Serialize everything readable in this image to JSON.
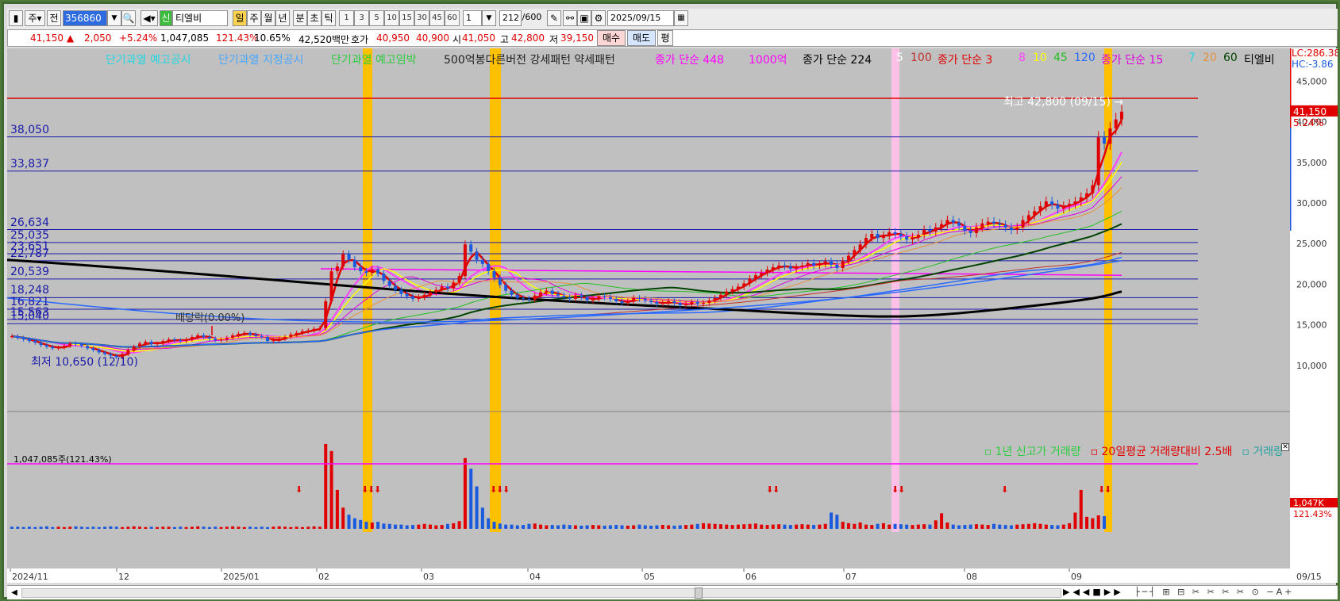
{
  "toolbar": {
    "market_select": "주",
    "prefix": "전",
    "code": "356860",
    "name_tag": "신",
    "stock_name": "티엘비",
    "period_tabs": [
      "일",
      "주",
      "월",
      "년",
      "분",
      "초",
      "틱"
    ],
    "num_buttons": [
      "1",
      "3",
      "5",
      "10",
      "15",
      "30",
      "45",
      "60"
    ],
    "interval_value": "1",
    "count_value": "212",
    "count_total": "/600",
    "date": "2025/09/15"
  },
  "pricebar": {
    "price": "41,150",
    "change_arrow": "▲",
    "change": "2,050",
    "change_pct": "+5.24%",
    "volume": "1,047,085",
    "vol_ratio": "121.43%",
    "turnover": "10.65%",
    "amount": "42,520백만",
    "quote_label": "호가",
    "ask": "40,950",
    "bid": "40,900",
    "open_label": "시",
    "open": "41,050",
    "high_label": "고",
    "high": "42,800",
    "low_label": "저",
    "low": "39,150",
    "buy_label": "매수",
    "sell_label": "매도",
    "avg_label": "평"
  },
  "legend": [
    {
      "text": "단기과열 예고공시",
      "color": "#22d8e0"
    },
    {
      "text": "단기과열 지정공시",
      "color": "#4aa8ff"
    },
    {
      "text": "단기과열 예고임박",
      "color": "#2ecc40"
    },
    {
      "text": "500억봉다른버전 강세패턴  약세패턴",
      "color": "#222222"
    },
    {
      "text": "종가 단순 448",
      "color": "#ff00ff"
    },
    {
      "text": "1000억",
      "color": "#ff00ff"
    },
    {
      "text": "종가 단순 224",
      "color": "#000000"
    },
    {
      "text": "5",
      "color": "#ffffff"
    },
    {
      "text": "100",
      "color": "#c0302a"
    },
    {
      "text": "종가 단순 3",
      "color": "#e00000"
    },
    {
      "text": "8",
      "color": "#ff40ff"
    },
    {
      "text": "10",
      "color": "#ffff00"
    },
    {
      "text": "45",
      "color": "#22c022"
    },
    {
      "text": "120",
      "color": "#2a6aff"
    },
    {
      "text": "종가 단순 15",
      "color": "#e000e0"
    },
    {
      "text": "7",
      "color": "#22d8e0"
    },
    {
      "text": "20",
      "color": "#e89040"
    },
    {
      "text": "60",
      "color": "#004400"
    },
    {
      "text": "티엘비",
      "color": "#000000"
    }
  ],
  "right_axis": {
    "lc": "LC:286.38",
    "hc": "HC:-3.86",
    "price_labels": [
      "45,000",
      "40,000",
      "35,000",
      "30,000",
      "25,000",
      "20,000",
      "15,000",
      "10,000"
    ],
    "current": "41,150",
    "current_pct": "5.24%",
    "volume_current": "1,047K",
    "volume_pct": "121.43%"
  },
  "hlines": [
    "38,050",
    "33,837",
    "26,634",
    "25,035",
    "23,651",
    "22,787",
    "20,539",
    "18,248",
    "16,821",
    "15,563",
    "15,040"
  ],
  "annotations": {
    "high": "최고 42,800 (09/15)",
    "low": "최저 10,650 (12/10)",
    "dividend": "배당락(0.00%)",
    "volume_label": "1,047,085주(121.43%)"
  },
  "volume_legend": [
    {
      "text": "1년 신고가 거래량",
      "color": "#2ecc40"
    },
    {
      "text": "20일평균 거래량대비 2.5배",
      "color": "#e00000"
    },
    {
      "text": "거래량",
      "color": "#22a0a0"
    }
  ],
  "x_labels": [
    "2024/11",
    "12",
    "2025/01",
    "02",
    "03",
    "04",
    "05",
    "06",
    "07",
    "08",
    "09"
  ],
  "x_end": "09/15",
  "colors": {
    "up": "#e00000",
    "down": "#1a5adf",
    "highlight": "#ffc000",
    "pink": "#ffc0e8"
  },
  "chart_data": {
    "type": "candlestick",
    "ylim": [
      5000,
      47000
    ],
    "closes": [
      13500,
      13300,
      13100,
      12900,
      12700,
      12400,
      12200,
      12000,
      12100,
      12300,
      12600,
      12500,
      12300,
      12000,
      11800,
      11500,
      11300,
      11100,
      10900,
      11300,
      11800,
      12200,
      12600,
      12800,
      12500,
      12600,
      12900,
      13100,
      13000,
      12900,
      13100,
      13400,
      13600,
      13400,
      13200,
      13000,
      13100,
      13300,
      13600,
      13800,
      13900,
      13700,
      13500,
      13400,
      12900,
      13000,
      13200,
      13400,
      13700,
      13900,
      14100,
      14200,
      14400,
      14500,
      17800,
      21500,
      22100,
      23600,
      22900,
      22000,
      21500,
      21300,
      21700,
      21200,
      20300,
      19700,
      19200,
      18700,
      18400,
      18100,
      18300,
      18600,
      18900,
      19200,
      19600,
      19400,
      20100,
      20900,
      24800,
      23900,
      22900,
      22400,
      21500,
      20700,
      19800,
      19100,
      18600,
      18200,
      18100,
      18000,
      18500,
      18900,
      19100,
      18700,
      18500,
      18300,
      18100,
      18500,
      18300,
      17900,
      18100,
      18400,
      18300,
      18100,
      17800,
      17600,
      17800,
      18200,
      18100,
      17900,
      17700,
      17500,
      17600,
      17800,
      17600,
      17300,
      17500,
      17700,
      17500,
      17600,
      17900,
      18200,
      18600,
      19000,
      19300,
      19600,
      20000,
      20600,
      21000,
      21300,
      21700,
      22000,
      22200,
      22100,
      21800,
      22000,
      22200,
      22500,
      22200,
      22400,
      22700,
      22300,
      21900,
      22800,
      23400,
      24100,
      24800,
      25600,
      26100,
      25600,
      25900,
      26300,
      26100,
      25800,
      25400,
      25700,
      26000,
      26600,
      26400,
      26900,
      27300,
      27800,
      27500,
      27100,
      26500,
      26200,
      26900,
      27400,
      27600,
      27400,
      27200,
      26900,
      26600,
      26900,
      27800,
      28400,
      28900,
      29500,
      30100,
      29700,
      29200,
      29500,
      29800,
      30100,
      30600,
      31100,
      32100,
      38000,
      37200,
      39100,
      40200,
      41150
    ],
    "volume": [
      6,
      6,
      5,
      6,
      5,
      6,
      7,
      5,
      6,
      5,
      6,
      7,
      6,
      5,
      6,
      5,
      6,
      7,
      6,
      5,
      6,
      7,
      6,
      5,
      6,
      5,
      6,
      6,
      5,
      6,
      5,
      6,
      7,
      6,
      5,
      6,
      5,
      6,
      7,
      6,
      5,
      6,
      5,
      6,
      5,
      6,
      7,
      6,
      5,
      6,
      5,
      6,
      7,
      6,
      240,
      220,
      110,
      60,
      40,
      30,
      25,
      20,
      18,
      20,
      15,
      14,
      12,
      12,
      10,
      11,
      12,
      14,
      12,
      10,
      11,
      14,
      16,
      22,
      200,
      170,
      120,
      60,
      30,
      20,
      15,
      12,
      12,
      10,
      11,
      14,
      15,
      12,
      10,
      11,
      10,
      12,
      11,
      10,
      9,
      10,
      11,
      10,
      9,
      10,
      11,
      10,
      9,
      10,
      12,
      10,
      9,
      10,
      11,
      10,
      9,
      10,
      11,
      12,
      14,
      16,
      15,
      14,
      13,
      12,
      11,
      12,
      13,
      14,
      15,
      12,
      11,
      12,
      13,
      12,
      11,
      12,
      13,
      12,
      11,
      12,
      14,
      46,
      40,
      20,
      16,
      14,
      18,
      12,
      11,
      14,
      16,
      12,
      14,
      13,
      12,
      11,
      12,
      13,
      12,
      24,
      44,
      18,
      12,
      10,
      11,
      12,
      13,
      12,
      11,
      14,
      12,
      11,
      10,
      12,
      13,
      14,
      16,
      14,
      12,
      11,
      10,
      12,
      16,
      46,
      110,
      34,
      30,
      38,
      36
    ],
    "volume_unit": "K"
  }
}
